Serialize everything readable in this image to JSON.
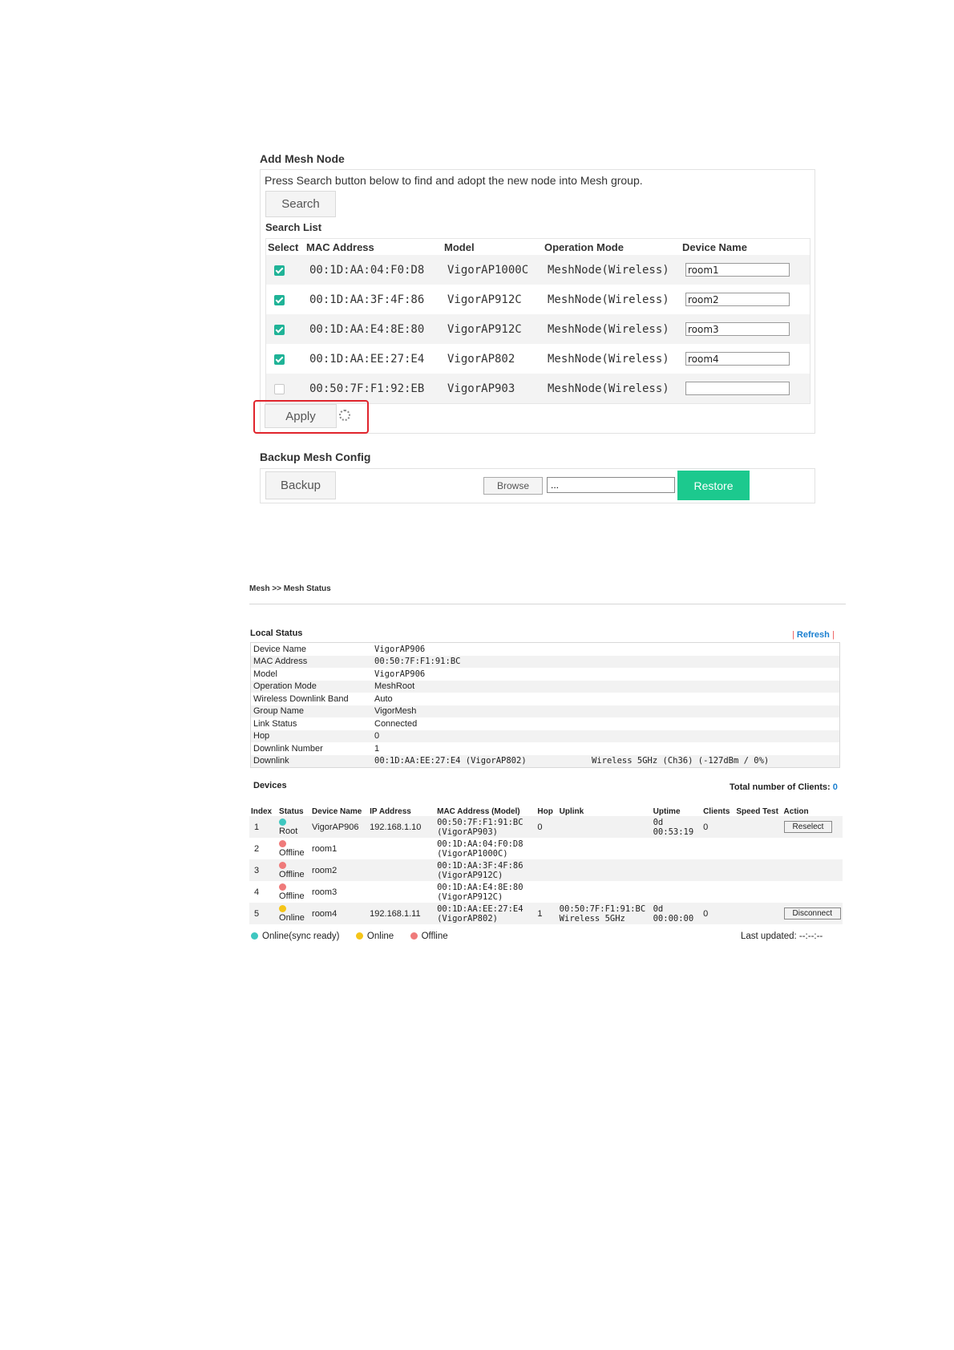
{
  "add_mesh": {
    "title": "Add Mesh Node",
    "instruction": "Press Search button below to find and adopt the new node into Mesh group.",
    "search_label": "Search",
    "search_list_title": "Search List",
    "columns": [
      "Select",
      "MAC Address",
      "Model",
      "Operation Mode",
      "Device Name"
    ],
    "rows": [
      {
        "checked": true,
        "mac": "00:1D:AA:04:F0:D8",
        "model": "VigorAP1000C",
        "mode": "MeshNode(Wireless)",
        "name": "room1"
      },
      {
        "checked": true,
        "mac": "00:1D:AA:3F:4F:86",
        "model": "VigorAP912C",
        "mode": "MeshNode(Wireless)",
        "name": "room2"
      },
      {
        "checked": true,
        "mac": "00:1D:AA:E4:8E:80",
        "model": "VigorAP912C",
        "mode": "MeshNode(Wireless)",
        "name": "room3"
      },
      {
        "checked": true,
        "mac": "00:1D:AA:EE:27:E4",
        "model": "VigorAP802",
        "mode": "MeshNode(Wireless)",
        "name": "room4"
      },
      {
        "checked": false,
        "mac": "00:50:7F:F1:92:EB",
        "model": "VigorAP903",
        "mode": "MeshNode(Wireless)",
        "name": ""
      }
    ],
    "apply_label": "Apply"
  },
  "backup": {
    "title": "Backup Mesh Config",
    "backup_label": "Backup",
    "browse_label": "Browse",
    "file_value": "...",
    "restore_label": "Restore"
  },
  "mesh_status": {
    "breadcrumb": "Mesh >> Mesh Status",
    "local_title": "Local Status",
    "refresh_label": "Refresh",
    "local_rows": [
      {
        "label": "Device Name",
        "value": "VigorAP906",
        "extra": ""
      },
      {
        "label": "MAC Address",
        "value": "00:50:7F:F1:91:BC",
        "extra": ""
      },
      {
        "label": "Model",
        "value": "VigorAP906",
        "extra": ""
      },
      {
        "label": "Operation Mode",
        "value": "MeshRoot",
        "extra": ""
      },
      {
        "label": "Wireless Downlink Band",
        "value": "Auto",
        "extra": ""
      },
      {
        "label": "Group Name",
        "value": "VigorMesh",
        "extra": ""
      },
      {
        "label": "Link Status",
        "value": "Connected",
        "extra": ""
      },
      {
        "label": "Hop",
        "value": "0",
        "extra": ""
      },
      {
        "label": "Downlink Number",
        "value": "1",
        "extra": ""
      },
      {
        "label": "Downlink",
        "value": "00:1D:AA:EE:27:E4 (VigorAP802)",
        "extra": "Wireless 5GHz (Ch36) (-127dBm / 0%)"
      }
    ],
    "devices_title": "Devices",
    "total_clients_label": "Total number of Clients:",
    "total_clients_value": "0",
    "device_columns": [
      "Index",
      "Status",
      "Device Name",
      "IP Address",
      "MAC Address (Model)",
      "Hop",
      "Uplink",
      "Uptime",
      "Clients",
      "Speed Test",
      "Action"
    ],
    "devices": [
      {
        "index": "1",
        "status": "Root",
        "status_color": "#3ec7c0",
        "name": "VigorAP906",
        "ip": "192.168.1.10",
        "mac": "00:50:7F:F1:91:BC",
        "model": "(VigorAP903)",
        "hop": "0",
        "uplink1": "",
        "uplink2": "",
        "uptime1": "0d",
        "uptime2": "00:53:19",
        "clients": "0",
        "action": "Reselect"
      },
      {
        "index": "2",
        "status": "Offline",
        "status_color": "#ef7a7a",
        "name": "room1",
        "ip": "",
        "mac": "00:1D:AA:04:F0:D8",
        "model": "(VigorAP1000C)",
        "hop": "",
        "uplink1": "",
        "uplink2": "",
        "uptime1": "",
        "uptime2": "",
        "clients": "",
        "action": ""
      },
      {
        "index": "3",
        "status": "Offline",
        "status_color": "#ef7a7a",
        "name": "room2",
        "ip": "",
        "mac": "00:1D:AA:3F:4F:86",
        "model": "(VigorAP912C)",
        "hop": "",
        "uplink1": "",
        "uplink2": "",
        "uptime1": "",
        "uptime2": "",
        "clients": "",
        "action": ""
      },
      {
        "index": "4",
        "status": "Offline",
        "status_color": "#ef7a7a",
        "name": "room3",
        "ip": "",
        "mac": "00:1D:AA:E4:8E:80",
        "model": "(VigorAP912C)",
        "hop": "",
        "uplink1": "",
        "uplink2": "",
        "uptime1": "",
        "uptime2": "",
        "clients": "",
        "action": ""
      },
      {
        "index": "5",
        "status": "Online",
        "status_color": "#f5c518",
        "name": "room4",
        "ip": "192.168.1.11",
        "mac": "00:1D:AA:EE:27:E4",
        "model": "(VigorAP802)",
        "hop": "1",
        "uplink1": "00:50:7F:F1:91:BC",
        "uplink2": "Wireless 5GHz",
        "uptime1": "0d",
        "uptime2": "00:00:00",
        "clients": "0",
        "action": "Disconnect"
      }
    ],
    "legend": [
      {
        "label": "Online(sync ready)",
        "color": "#3ec7c0"
      },
      {
        "label": "Online",
        "color": "#f5c518"
      },
      {
        "label": "Offline",
        "color": "#ef7a7a"
      }
    ],
    "last_updated": "Last updated: --:--:--"
  },
  "colors": {
    "accent": "#1cc98e",
    "highlight": "#e0242c",
    "link": "#1a7fd0"
  }
}
